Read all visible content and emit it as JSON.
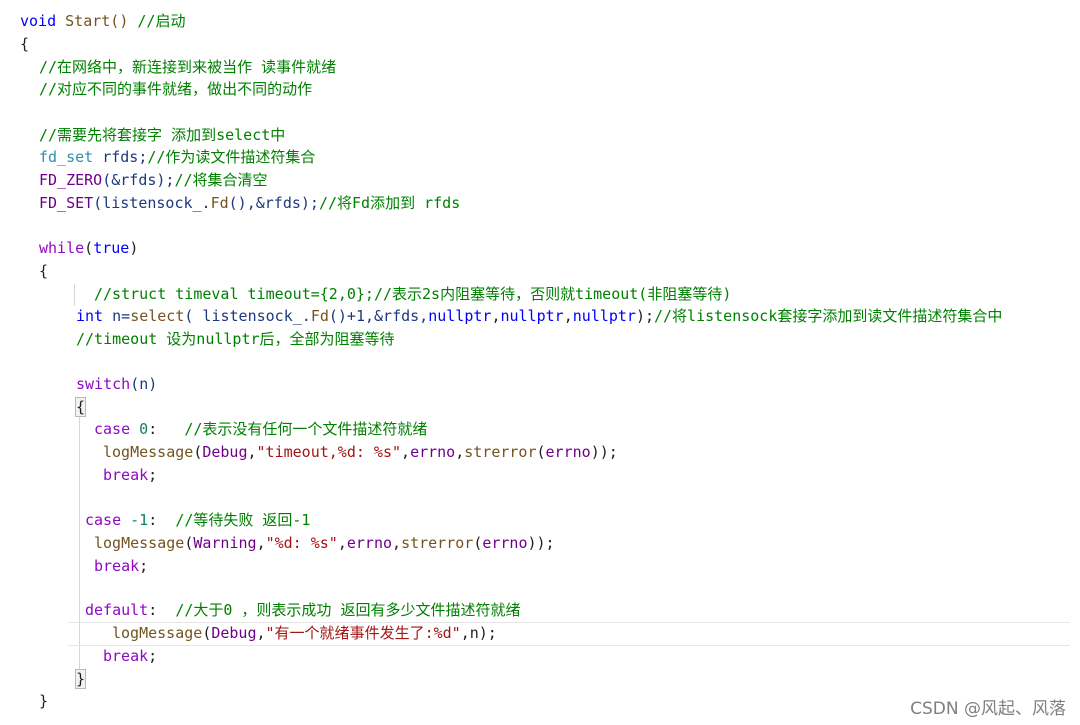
{
  "code_lines": [
    [
      "void",
      " Start() ",
      "//启动"
    ],
    [
      "{"
    ],
    [
      "//在网络中，新连接到来被当作 读事件就绪"
    ],
    [
      "//对应不同的事件就绪，做出不同的动作"
    ],
    [
      "//需要先将套接字 添加到select中"
    ],
    [
      "fd_set",
      " rfds;",
      "//作为读文件描述符集合"
    ],
    [
      "FD_ZERO",
      "(&rfds);",
      "//将集合清空"
    ],
    [
      "FD_SET",
      "(listensock_.",
      "Fd",
      "(),&rfds);",
      "//将Fd添加到 rfds"
    ],
    [
      "while",
      "(",
      "true",
      ")"
    ],
    [
      "{"
    ],
    [
      "//struct timeval timeout={2,0};//表示2s内阻塞等待，否则就timeout(非阻塞等待)"
    ],
    [
      "int",
      " n=",
      "select",
      "( listensock_.",
      "Fd",
      "()+1,&rfds,",
      "nullptr",
      ",",
      "nullptr",
      ",",
      "nullptr",
      ");",
      "//将listensock套接字添加到读文件描述符集合中"
    ],
    [
      "//timeout 设为nullptr后，全部为阻塞等待"
    ],
    [
      "switch",
      "(n)"
    ],
    [
      "{"
    ],
    [
      "case",
      " ",
      "0",
      ":   ",
      "//表示没有任何一个文件描述符就绪"
    ],
    [
      "logMessage",
      "(",
      "Debug",
      ",",
      "\"timeout,%d: %s\"",
      ",",
      "errno",
      ",",
      "strerror",
      "(",
      "errno",
      "));"
    ],
    [
      "break",
      ";"
    ],
    [
      "case",
      " ",
      "-1",
      ":  ",
      "//等待失败 返回-1"
    ],
    [
      "logMessage",
      "(",
      "Warning",
      ",",
      "\"%d: %s\"",
      ",",
      "errno",
      ",",
      "strerror",
      "(",
      "errno",
      "));"
    ],
    [
      "break",
      ";"
    ],
    [
      "default",
      ":  ",
      "//大于0 ，则表示成功 返回有多少文件描述符就绪"
    ],
    [
      "logMessage",
      "(",
      "Debug",
      ",",
      "\"有一个就绪事件发生了:%d\"",
      ",n);"
    ],
    [
      "break",
      ";"
    ],
    [
      "}"
    ],
    [
      "}"
    ]
  ],
  "watermark": "CSDN @风起、风落"
}
